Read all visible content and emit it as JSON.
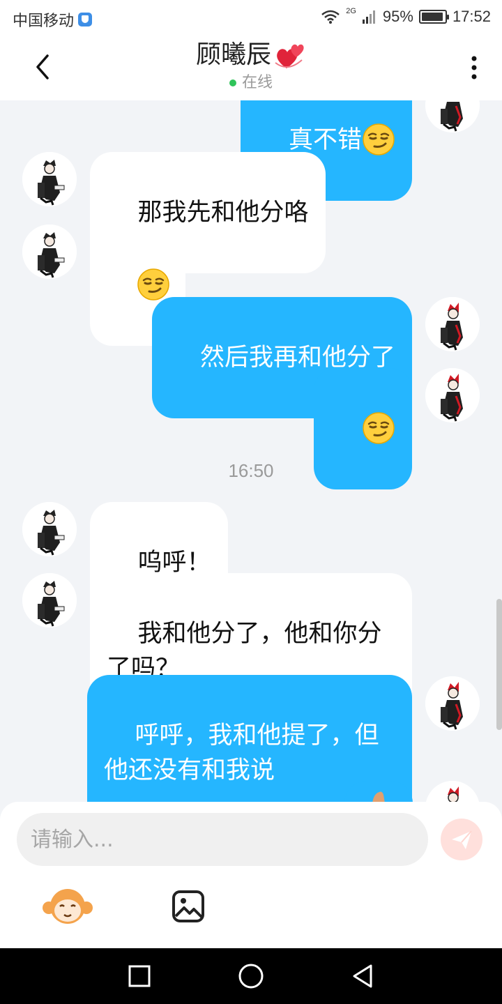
{
  "status_bar": {
    "carrier": "中国移动",
    "network": "2G",
    "battery": "95%",
    "battery_level": 0.95,
    "time": "17:52"
  },
  "header": {
    "name": "顾曦辰",
    "name_emoji": "hearts-icon",
    "presence": "在线"
  },
  "messages": [
    {
      "side": "out",
      "text": "真不错",
      "emoji": "smirk"
    },
    {
      "side": "in",
      "text": "那我先和他分咯"
    },
    {
      "side": "in",
      "text": "",
      "emoji": "smirk"
    },
    {
      "side": "out",
      "text": "然后我再和他分了"
    },
    {
      "side": "out",
      "text": "",
      "emoji": "smirk"
    },
    {
      "type": "time",
      "text": "16:50"
    },
    {
      "side": "in",
      "text": "呜呼！"
    },
    {
      "side": "in",
      "text": "我和他分了，他和你分\n了吗？"
    },
    {
      "side": "out",
      "text": "呼呼，我和他提了，但\n他还没有和我说"
    },
    {
      "side": "out",
      "text": "",
      "emoji": "partial"
    }
  ],
  "composer": {
    "placeholder": "请输入..."
  },
  "colors": {
    "outgoing_bubble": "#25b6ff",
    "incoming_bubble": "#ffffff",
    "background": "#f2f4f7",
    "online": "#2fc45a"
  }
}
